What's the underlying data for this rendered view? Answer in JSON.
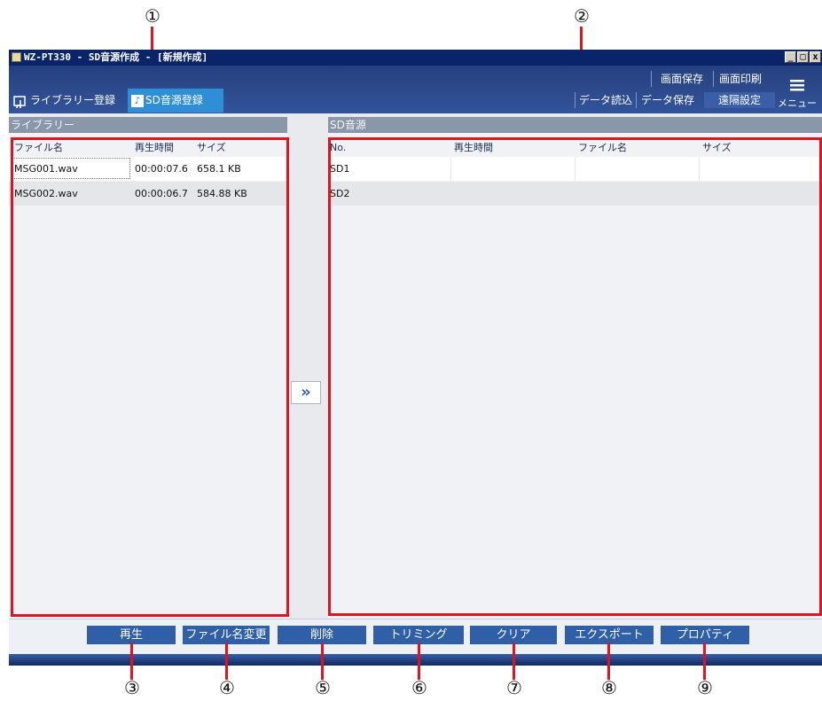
{
  "callouts": [
    "①",
    "②",
    "③",
    "④",
    "⑤",
    "⑥",
    "⑦",
    "⑧",
    "⑨"
  ],
  "window": {
    "title": "WZ-PT330 - SD音源作成 - [新規作成]",
    "min": "_",
    "max": "□",
    "close": "x"
  },
  "toolbar": {
    "tab_library": "ライブラリー登録",
    "tab_sd": "SD音源登録",
    "screen_save": "画面保存",
    "screen_print": "画面印刷",
    "data_load": "データ読込",
    "data_save": "データ保存",
    "remote_settings": "遠隔設定",
    "menu": "メニュー"
  },
  "library": {
    "header": "ライブラリー",
    "columns": [
      "ファイル名",
      "再生時間",
      "サイズ"
    ],
    "rows": [
      {
        "name": "MSG001.wav",
        "time": "00:00:07.6",
        "size": "658.1 KB"
      },
      {
        "name": "MSG002.wav",
        "time": "00:00:06.7",
        "size": "584.88 KB"
      }
    ]
  },
  "transfer_button": "»",
  "sd": {
    "header": "SD音源",
    "columns": [
      "No.",
      "再生時間",
      "ファイル名",
      "サイズ"
    ],
    "rows": [
      {
        "no": "SD1"
      },
      {
        "no": "SD2"
      }
    ]
  },
  "actions": {
    "play": "再生",
    "rename": "ファイル名変更",
    "delete": "削除",
    "trim": "トリミング",
    "clear": "クリア",
    "export": "エクスポート",
    "properties": "プロパティ"
  },
  "colors": {
    "highlight": "#e0141e",
    "active_tab": "#2f8fd6",
    "button": "#2f5fa6",
    "toolbar": "#2a4a8c"
  }
}
